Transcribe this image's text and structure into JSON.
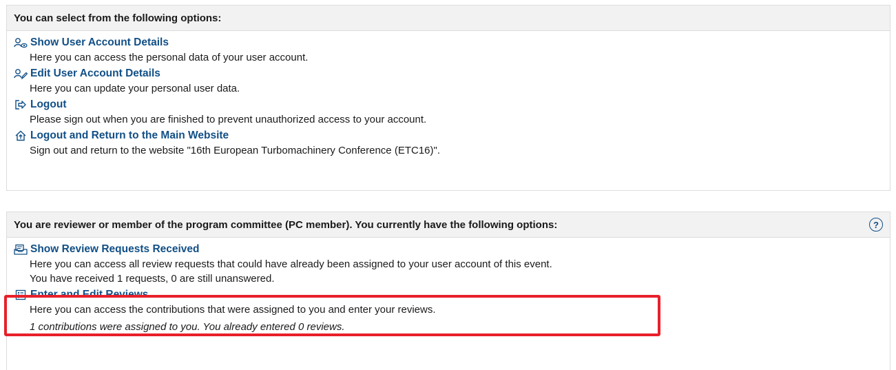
{
  "panel1": {
    "header": "You can select from the following options:",
    "options": [
      {
        "title": "Show User Account Details",
        "desc": "Here you can access the personal data of your user account.",
        "icon": "user-view-icon"
      },
      {
        "title": "Edit User Account Details",
        "desc": "Here you can update your personal user data.",
        "icon": "user-edit-icon"
      },
      {
        "title": "Logout",
        "desc": "Please sign out when you are finished to prevent unauthorized access to your account.",
        "icon": "logout-icon"
      },
      {
        "title": "Logout and Return to the Main Website",
        "desc": "Sign out and return to the website \"16th European Turbomachinery Conference (ETC16)\".",
        "icon": "home-logout-icon"
      }
    ]
  },
  "panel2": {
    "header": "You are reviewer or member of the program committee (PC member). You currently have the following options:",
    "help_symbol": "?",
    "options": [
      {
        "title": "Show Review Requests Received",
        "desc": "Here you can access all review requests that could have already been assigned to your user account of this event.",
        "desc2": "You have received 1 requests, 0 are still unanswered.",
        "icon": "review-requests-icon"
      },
      {
        "title": "Enter and Edit Reviews",
        "desc": "Here you can access the contributions that were assigned to you and enter your reviews.",
        "icon": "review-list-icon"
      }
    ],
    "note": "1 contributions were assigned to you. You already entered 0 reviews."
  },
  "colors": {
    "link": "#114f86",
    "highlight": "#e8202a",
    "header_bg": "#f2f2f2"
  }
}
